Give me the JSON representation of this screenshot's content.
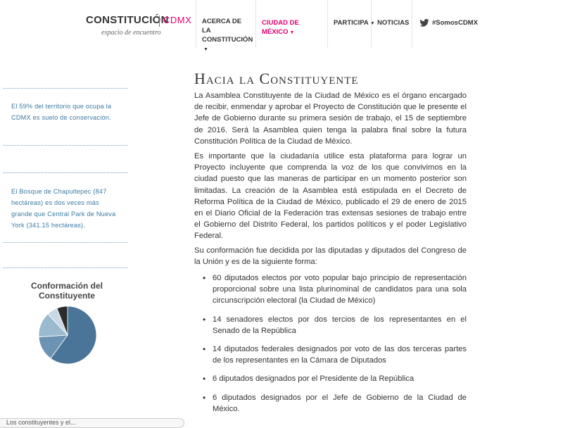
{
  "header": {
    "logo": {
      "name": "CONSTITUCIÓN",
      "cdmx": "CDMX",
      "tagline": "espacio de encuentro"
    },
    "nav": [
      {
        "label": "ACERCA DE LA CONSTITUCIÓN",
        "has_dropdown": true,
        "active": false
      },
      {
        "label": "CIUDAD DE MÉXICO",
        "has_dropdown": true,
        "active": true
      },
      {
        "label": "PARTICIPA",
        "has_dropdown": true,
        "active": false
      },
      {
        "label": "NOTICIAS",
        "has_dropdown": false,
        "active": false
      },
      {
        "label": "#SomosCDMX",
        "icon": "twitter-icon",
        "active": false
      }
    ],
    "active_color": "#e6006f"
  },
  "sidebar": {
    "facts": [
      "El 59% del territorio que ocupa la CDMX es suelo de conservación.",
      "El Bosque de Chapultepec (847 hectáreas) es dos veces más grande que Central Park de Nueva York (341.15 hectáreas)."
    ],
    "chart_title": "Conformación del Constituyente",
    "bottom_text": "Los constituyentes y el..."
  },
  "main": {
    "title": "Hacia la Constituyente",
    "paragraphs": [
      "La Asamblea Constituyente de la Ciudad de México es el órgano encargado de recibir, enmendar y aprobar el Proyecto de Constitución que le presente el Jefe de Gobierno durante su primera sesión de trabajo, el 15 de septiembre de 2016. Será la Asamblea quien tenga la palabra final sobre la futura Constitución Política de la Ciudad de México.",
      "Es importante que la ciudadanía utilice esta plataforma para lograr un Proyecto incluyente que comprenda la voz de los que convivimos en la ciudad puesto que las maneras de participar en un momento posterior son limitadas. La creación de la Asamblea está estipulada en el Decreto de Reforma Política de la Ciudad de México, publicado el 29 de enero de 2015 en el Diario Oficial de la Federación tras extensas sesiones de trabajo entre el Gobierno del Distrito Federal, los partidos políticos y el poder Legislativo Federal.",
      "Su conformación fue decidida por las diputadas y diputados del Congreso de la Unión y es de la siguiente forma:"
    ],
    "bullets": [
      "60 diputados electos por voto popular bajo principio de representación proporcional sobre una lista plurinominal de candidatos para una sola circunscripción electoral (la Ciudad de México)",
      "14 senadores electos por dos tercios de los representantes en el Senado de la República",
      "14 diputados federales designados por voto de las dos terceras partes de los representantes en la Cámara de Diputados",
      "6 diputados designados por el Presidente de la República",
      "6 diputados designados por el Jefe de Gobierno de la Ciudad de México."
    ]
  },
  "chart_data": {
    "type": "pie",
    "title": "Conformación del Constituyente",
    "values": [
      60,
      14,
      14,
      6,
      6
    ],
    "colors": [
      "#4a7598",
      "#6c93b3",
      "#9bb9cf",
      "#c9d8e4",
      "#2b2b2b"
    ]
  }
}
